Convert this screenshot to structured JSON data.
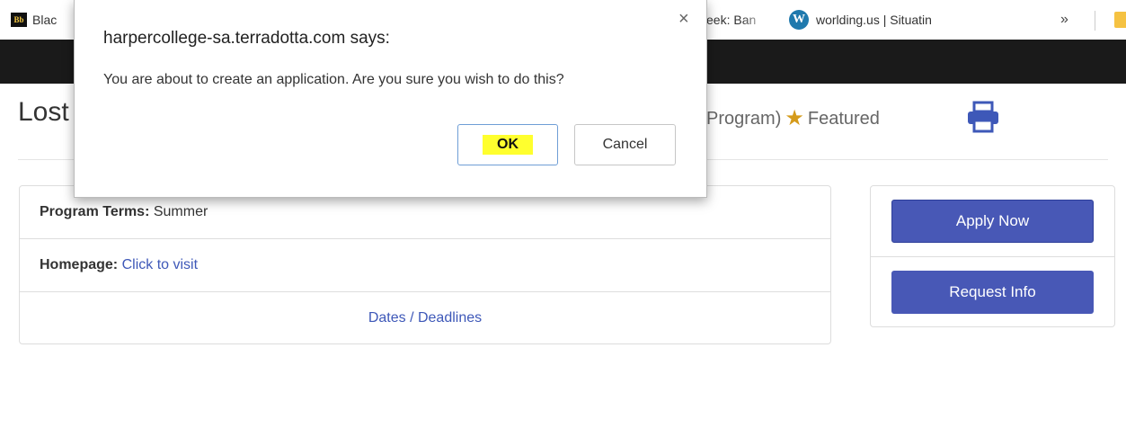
{
  "bookmarks": {
    "items": [
      {
        "label": "Blac",
        "icon": "blackboard-icon"
      },
      {
        "label": "eek: Ban",
        "icon": ""
      },
      {
        "label": "worlding.us | Situatin",
        "icon": "wordpress-icon"
      }
    ],
    "overflow": "»"
  },
  "page": {
    "title": "Lost",
    "meta_prefix": "Program)",
    "featured": "Featured"
  },
  "info": {
    "terms_label": "Program Terms:",
    "terms_value": "Summer",
    "homepage_label": "Homepage:",
    "homepage_link": "Click to visit",
    "dates_link": "Dates / Deadlines"
  },
  "actions": {
    "apply": "Apply Now",
    "request": "Request Info"
  },
  "dialog": {
    "title": "harpercollege-sa.terradotta.com says:",
    "message": "You are about to create an application. Are you sure you wish to do this?",
    "ok": "OK",
    "cancel": "Cancel",
    "close": "×"
  },
  "colors": {
    "primary": "#4858b6",
    "link": "#3e58b8",
    "star": "#d59b1b",
    "highlight": "#ffff2e",
    "nav": "#1a1a1a"
  }
}
